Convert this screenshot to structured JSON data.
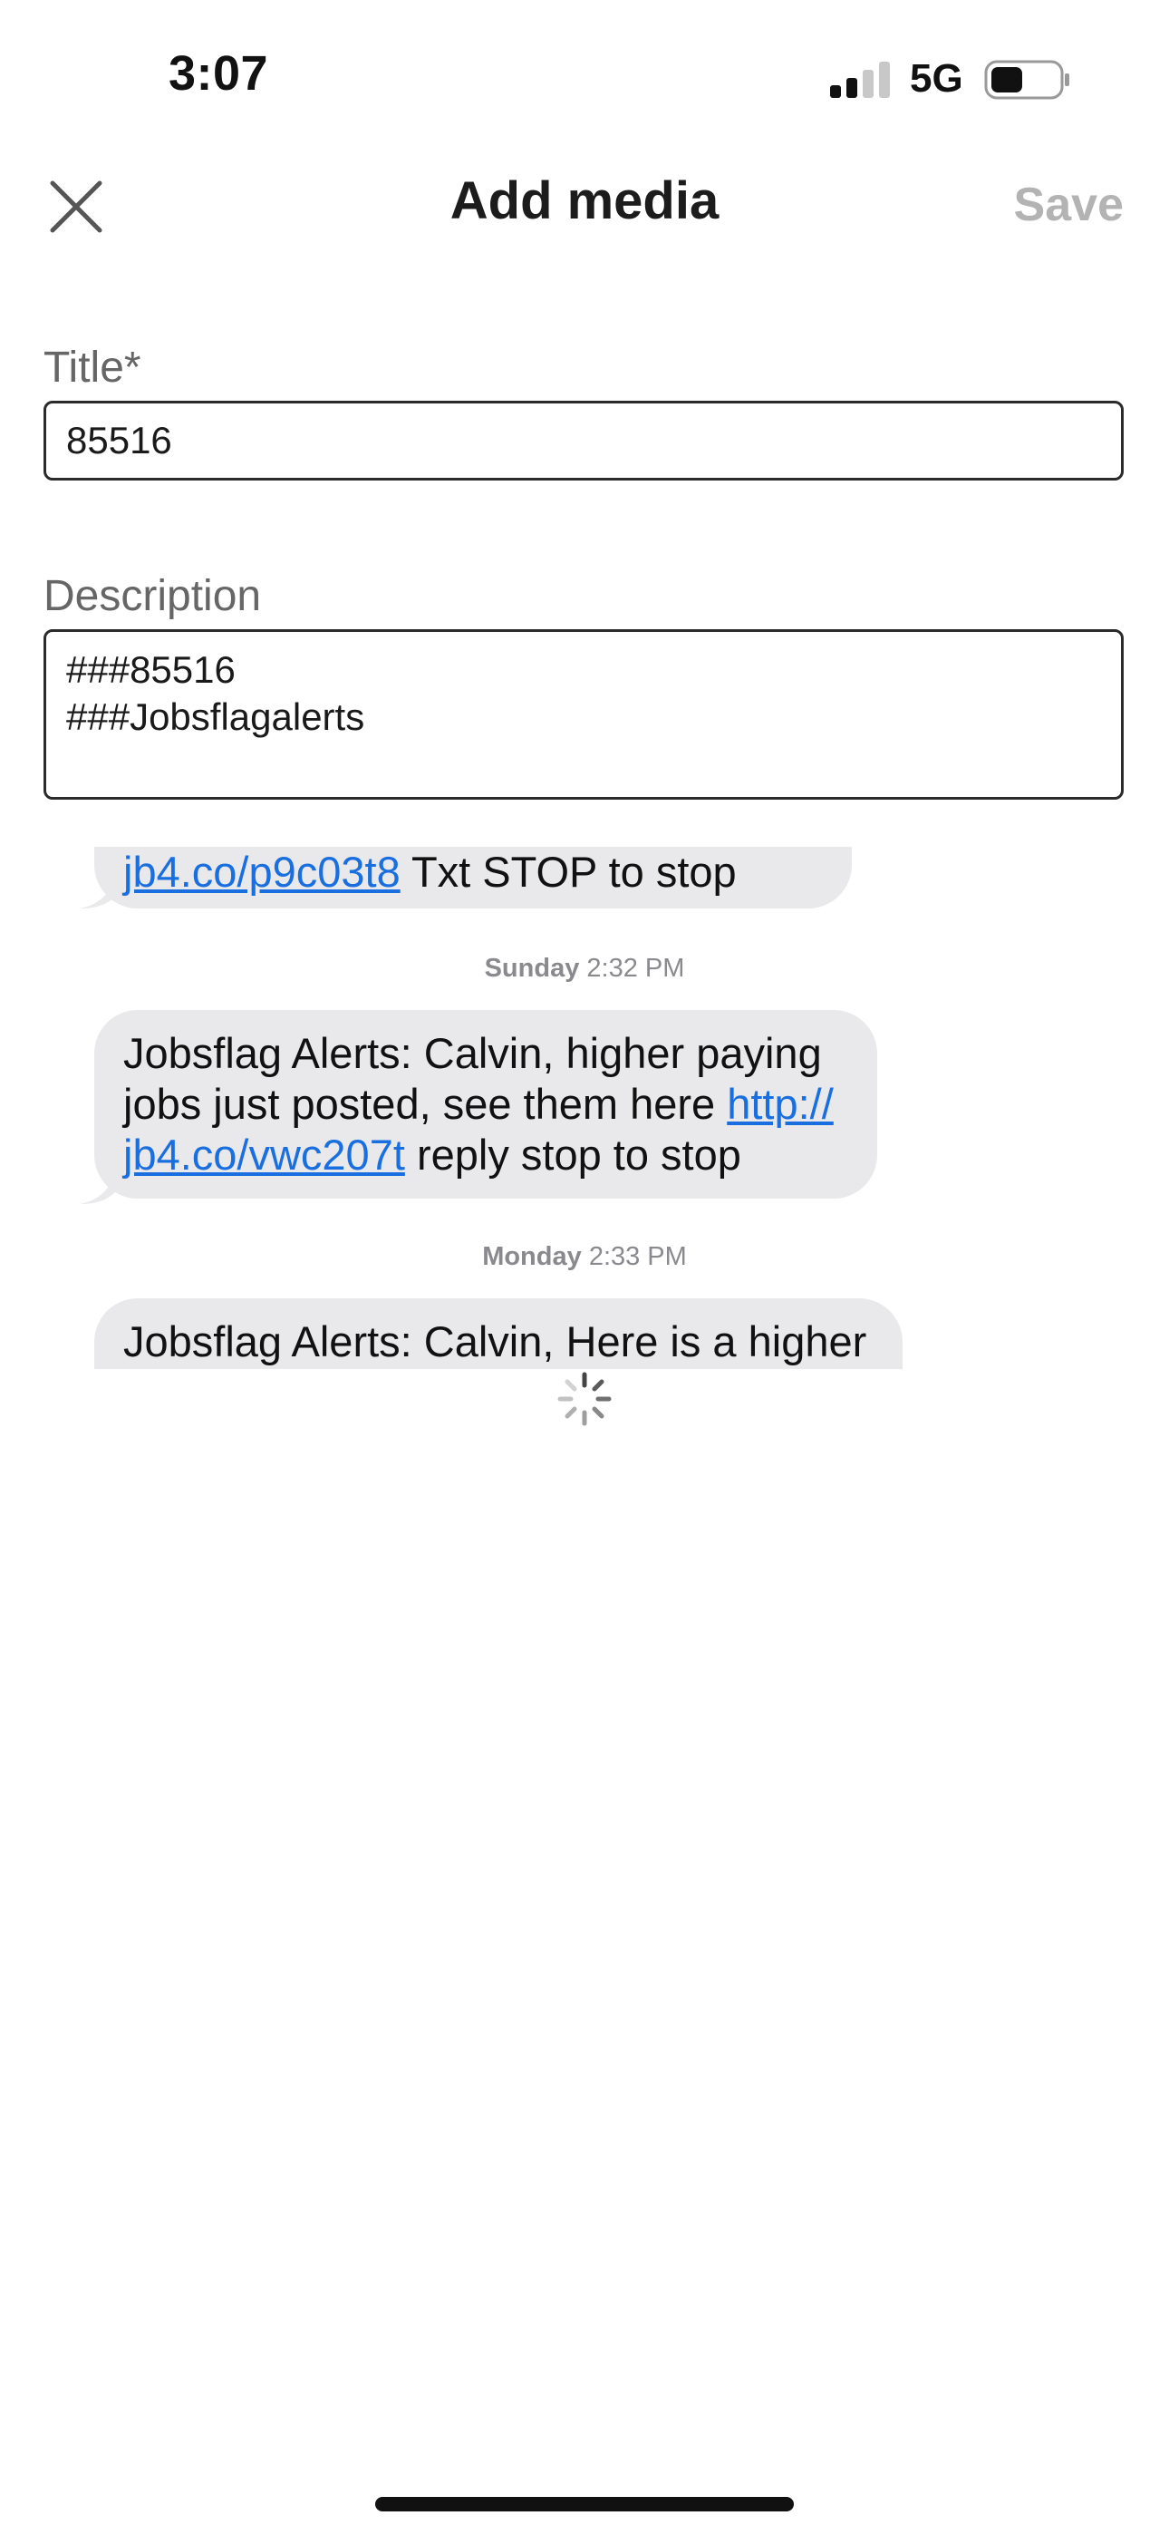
{
  "status_bar": {
    "time": "3:07",
    "network": "5G",
    "icons": [
      "signal-icon",
      "battery-icon"
    ]
  },
  "header": {
    "title": "Add media",
    "save_label": "Save",
    "close_icon": "close-icon"
  },
  "form": {
    "title_label": "Title*",
    "title_value": "85516",
    "description_label": "Description",
    "description_value": "###85516\n###Jobsflagalerts"
  },
  "media_preview": {
    "messages": [
      {
        "link": "jb4.co/p9c03t8",
        "text_after": " Txt STOP to stop"
      },
      {
        "timestamp_day": "Sunday",
        "timestamp_time": "2:32 PM",
        "line1": "Jobsflag Alerts: Calvin, higher paying",
        "line2_text": "jobs just posted, see them here ",
        "line2_link": "http://",
        "line3_link": "jb4.co/vwc207t",
        "line3_text": " reply stop to stop"
      },
      {
        "timestamp_day": "Monday",
        "timestamp_time": "2:33 PM",
        "text": "Jobsflag Alerts: Calvin, Here is a higher"
      }
    ]
  },
  "loading_icon": "spinner-icon",
  "colors": {
    "accent_link": "#1a6fe0",
    "bubble_bg": "#e9e9eb",
    "save_disabled": "#b3b3b3",
    "label_gray": "#666666"
  }
}
